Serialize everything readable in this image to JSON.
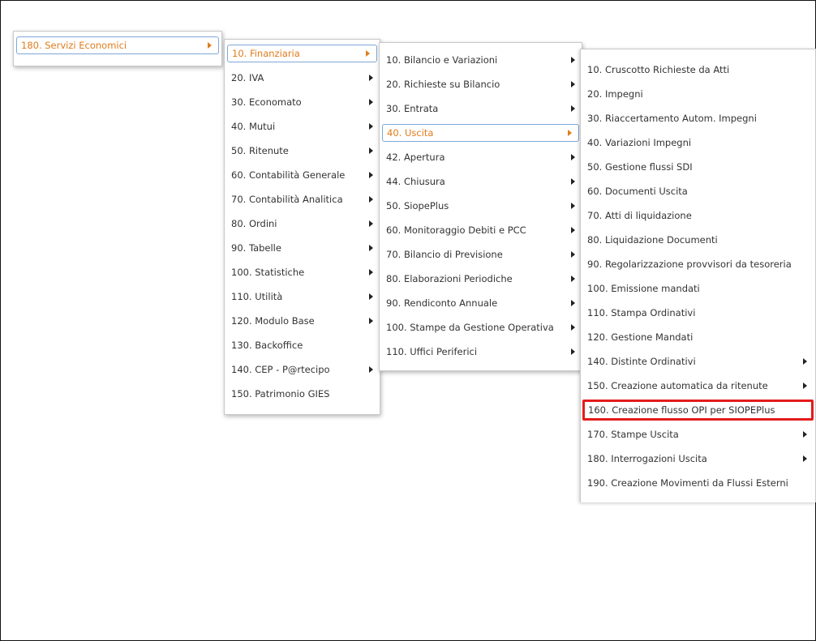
{
  "menus": [
    {
      "items": [
        {
          "label": "180. Servizi Economici",
          "submenu": true,
          "active": true
        }
      ]
    },
    {
      "items": [
        {
          "label": "10. Finanziaria",
          "submenu": true,
          "active": true
        },
        {
          "label": "20. IVA",
          "submenu": true
        },
        {
          "label": "30. Economato",
          "submenu": true
        },
        {
          "label": "40. Mutui",
          "submenu": true
        },
        {
          "label": "50. Ritenute",
          "submenu": true
        },
        {
          "label": "60. Contabilità Generale",
          "submenu": true
        },
        {
          "label": "70. Contabilità Analitica",
          "submenu": true
        },
        {
          "label": "80. Ordini",
          "submenu": true
        },
        {
          "label": "90. Tabelle",
          "submenu": true
        },
        {
          "label": "100. Statistiche",
          "submenu": true
        },
        {
          "label": "110. Utilità",
          "submenu": true
        },
        {
          "label": "120. Modulo Base",
          "submenu": true
        },
        {
          "label": "130. Backoffice",
          "submenu": false
        },
        {
          "label": "140. CEP - P@rtecipo",
          "submenu": true
        },
        {
          "label": "150. Patrimonio GIES",
          "submenu": false
        }
      ]
    },
    {
      "items": [
        {
          "label": "10. Bilancio e Variazioni",
          "submenu": true
        },
        {
          "label": "20. Richieste su Bilancio",
          "submenu": true
        },
        {
          "label": "30. Entrata",
          "submenu": true
        },
        {
          "label": "40. Uscita",
          "submenu": true,
          "active": true
        },
        {
          "label": "42. Apertura",
          "submenu": true
        },
        {
          "label": "44. Chiusura",
          "submenu": true
        },
        {
          "label": "50. SiopePlus",
          "submenu": true
        },
        {
          "label": "60. Monitoraggio Debiti e PCC",
          "submenu": true
        },
        {
          "label": "70. Bilancio di Previsione",
          "submenu": true
        },
        {
          "label": "80. Elaborazioni Periodiche",
          "submenu": true
        },
        {
          "label": "90. Rendiconto Annuale",
          "submenu": true
        },
        {
          "label": "100. Stampe da Gestione Operativa",
          "submenu": true
        },
        {
          "label": "110. Uffici Periferici",
          "submenu": true
        }
      ]
    },
    {
      "items": [
        {
          "label": "10. Cruscotto Richieste da Atti",
          "submenu": false
        },
        {
          "label": "20. Impegni",
          "submenu": false
        },
        {
          "label": "30. Riaccertamento Autom. Impegni",
          "submenu": false
        },
        {
          "label": "40. Variazioni Impegni",
          "submenu": false
        },
        {
          "label": "50. Gestione flussi SDI",
          "submenu": false
        },
        {
          "label": "60. Documenti Uscita",
          "submenu": false
        },
        {
          "label": "70. Atti di liquidazione",
          "submenu": false
        },
        {
          "label": "80. Liquidazione Documenti",
          "submenu": false
        },
        {
          "label": "90. Regolarizzazione provvisori da tesoreria",
          "submenu": false
        },
        {
          "label": "100. Emissione mandati",
          "submenu": false
        },
        {
          "label": "110. Stampa Ordinativi",
          "submenu": false
        },
        {
          "label": "120. Gestione Mandati",
          "submenu": false
        },
        {
          "label": "140. Distinte Ordinativi",
          "submenu": true
        },
        {
          "label": "150. Creazione automatica da ritenute",
          "submenu": true
        },
        {
          "label": "160. Creazione flusso OPI per SIOPEPlus",
          "submenu": false,
          "highlight": true
        },
        {
          "label": "170. Stampe Uscita",
          "submenu": true
        },
        {
          "label": "180. Interrogazioni Uscita",
          "submenu": true
        },
        {
          "label": "190. Creazione Movimenti da Flussi Esterni",
          "submenu": false
        }
      ]
    }
  ],
  "colors": {
    "active_text": "#e07c1c",
    "active_border": "#7ea7d8",
    "highlight_border": "#e41b1b",
    "text": "#333333"
  }
}
